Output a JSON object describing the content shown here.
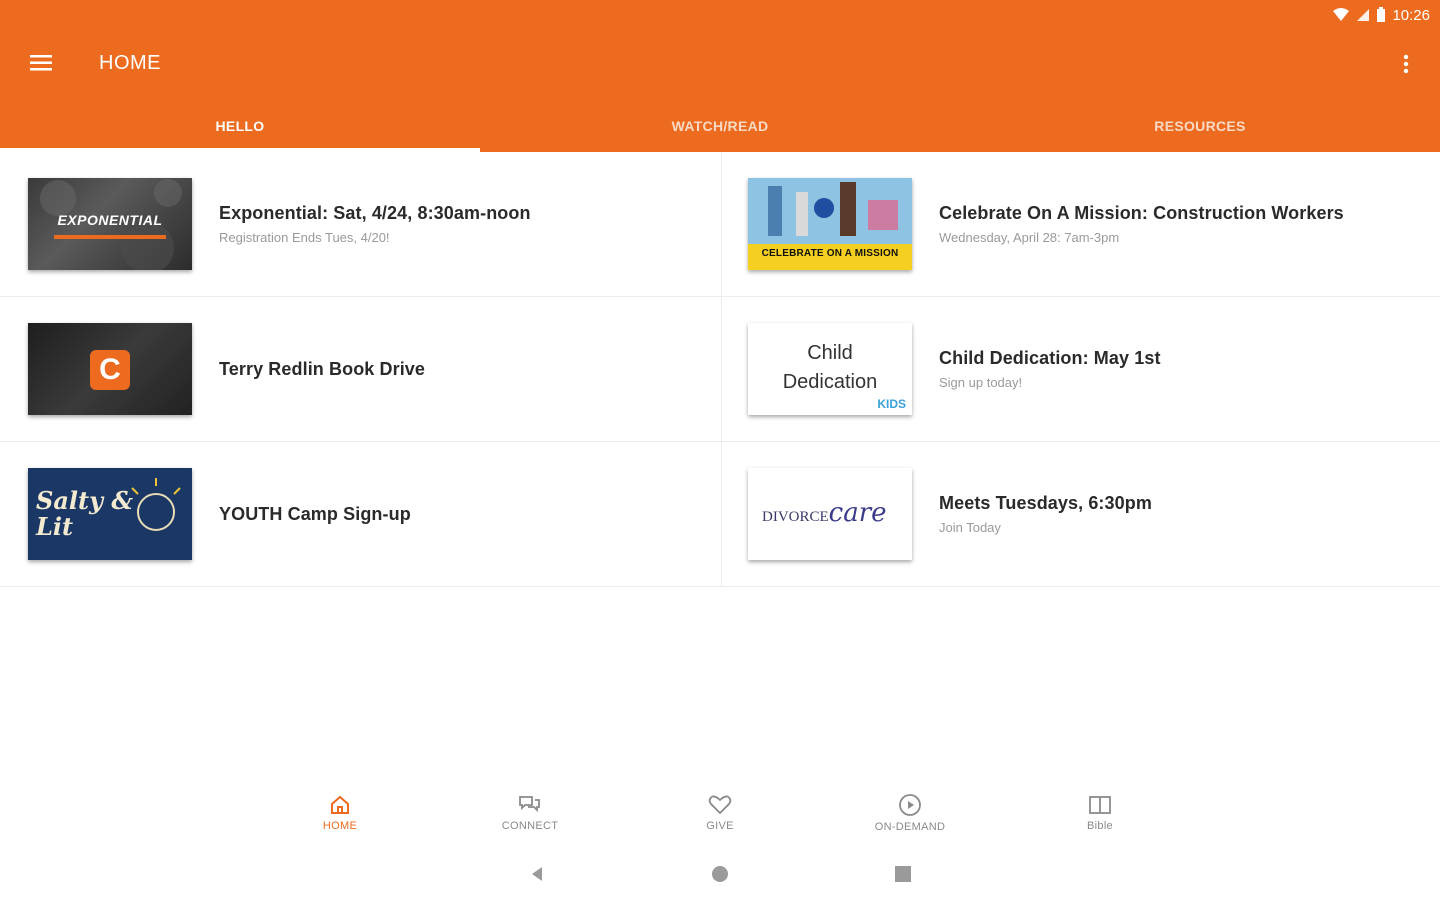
{
  "status_bar": {
    "time": "10:26"
  },
  "app_bar": {
    "title": "HOME"
  },
  "tabs": [
    {
      "label": "HELLO",
      "active": true
    },
    {
      "label": "WATCH/READ",
      "active": false
    },
    {
      "label": "RESOURCES",
      "active": false
    }
  ],
  "cards": [
    {
      "title": "Exponential: Sat, 4/24, 8:30am-noon",
      "subtitle": "Registration Ends Tues, 4/20!",
      "thumb_text": "EXPONENTIAL"
    },
    {
      "title": "Celebrate On A Mission: Construction Workers",
      "subtitle": "Wednesday, April 28: 7am-3pm",
      "thumb_text": "CELEBRATE ON A MISSION"
    },
    {
      "title": "Terry Redlin Book Drive",
      "subtitle": "",
      "thumb_text": "C"
    },
    {
      "title": "Child Dedication: May 1st",
      "subtitle": "Sign up today!",
      "thumb_text": "Child Dedication",
      "thumb_badge": "KIDS"
    },
    {
      "title": "YOUTH Camp Sign-up",
      "subtitle": "",
      "thumb_text": "Salty & Lit"
    },
    {
      "title": "Meets Tuesdays, 6:30pm",
      "subtitle": "Join Today",
      "thumb_text": "DIVORCE",
      "thumb_text2": "care"
    }
  ],
  "bottom_nav": [
    {
      "label": "HOME",
      "icon": "home-icon",
      "active": true
    },
    {
      "label": "CONNECT",
      "icon": "chat-icon",
      "active": false
    },
    {
      "label": "GIVE",
      "icon": "heart-icon",
      "active": false
    },
    {
      "label": "ON-DEMAND",
      "icon": "play-icon",
      "active": false
    },
    {
      "label": "Bible",
      "icon": "book-icon",
      "active": false
    }
  ],
  "colors": {
    "brand": "#ec6b1f",
    "text": "#2a2a2a",
    "muted": "#9a9a9a"
  }
}
